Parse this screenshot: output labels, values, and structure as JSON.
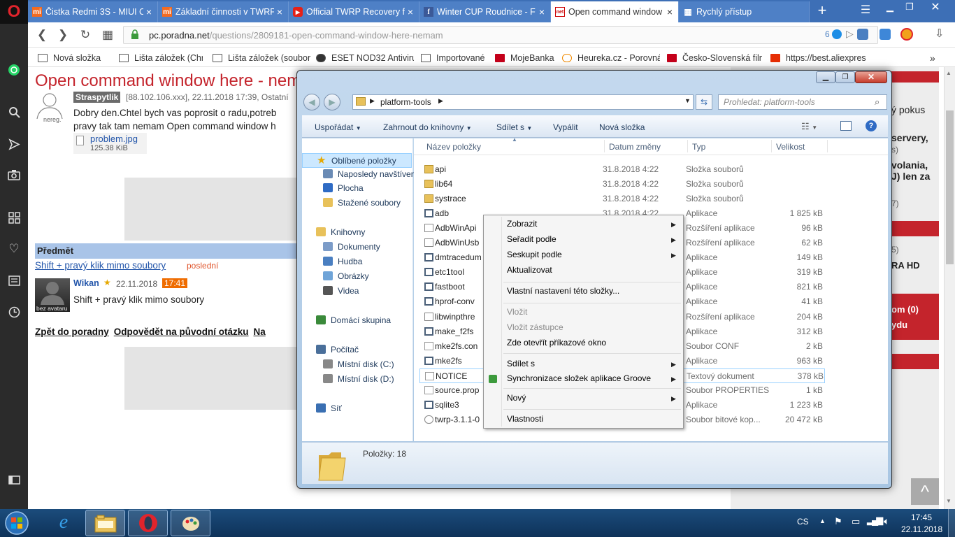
{
  "browser": {
    "tabs": [
      {
        "label": "Čistka Redmi 3S - MIUI C",
        "fav": "mi"
      },
      {
        "label": "Základní činnosti v TWRP",
        "fav": "mi"
      },
      {
        "label": "Official TWRP Recovery f",
        "fav": "yt"
      },
      {
        "label": "Winter CUP Roudnice - F",
        "fav": "fb"
      },
      {
        "label": "Open command window",
        "fav": "net"
      },
      {
        "label": "Rychlý přístup",
        "fav": "grid"
      }
    ],
    "url_host": "pc.poradna.net",
    "url_path": "/questions/2809181-open-command-window-here-nemam",
    "badge_count": "6",
    "bookmarks": [
      "Nová složka",
      "Lišta záložek (Chrome",
      "Lišta záložek (soubor)",
      "ESET NOD32 Antiviru",
      "Importované",
      "MojeBanka",
      "Heureka.cz - Porovná",
      "Česko-Slovenská film",
      "https://best.aliexpres"
    ],
    "bookmarks_more": "»"
  },
  "page": {
    "title": "Open command window here - nemam",
    "author": "Straspytlik",
    "meta": "[88.102.106.xxx], 22.11.2018 17:39, Ostatní",
    "unreg_label": "nereg.",
    "question_line1": "Dobry den.Chtel bych vas poprosit o radu,potreb",
    "question_line2": "pravy tak tam nemam Open command window h",
    "attachment_name": "problem.jpg",
    "attachment_size": "125.38 KiB",
    "subject_header": "Předmět",
    "reply_link": "Shift + pravý klik mimo soubory",
    "reply_tag": "poslední",
    "reply_author": "Wikan",
    "reply_date": "22.11.2018",
    "reply_time": "17:41",
    "avatar_label": "bez avataru",
    "reply_text": "Shift + pravý klik mimo soubory",
    "links": [
      "Zpět do poradny",
      "Odpovědět na původní otázku",
      "Na"
    ],
    "right_fragments": [
      "ý pokus",
      "servery,",
      "s)",
      "volania,",
      "J) len za",
      "7)",
      "5)",
      "RA HD",
      "om (0)",
      "ydu"
    ],
    "scroll_up": "^"
  },
  "explorer": {
    "path": "platform-tools",
    "search_placeholder": "Prohledat: platform-tools",
    "toolbar": [
      "Uspořádat",
      "Zahrnout do knihovny",
      "Sdílet s",
      "Vypálit",
      "Nová složka"
    ],
    "nav": [
      {
        "label": "Oblíbené položky",
        "icon": "star-icon",
        "level": 0
      },
      {
        "label": "Naposledy navštíven",
        "icon": "recent-icon",
        "level": 1
      },
      {
        "label": "Plocha",
        "icon": "desktop-icon",
        "level": 1
      },
      {
        "label": "Stažené soubory",
        "icon": "download-folder-icon",
        "level": 1
      },
      {
        "label": "Knihovny",
        "icon": "library-icon",
        "level": 0
      },
      {
        "label": "Dokumenty",
        "icon": "documents-icon",
        "level": 1
      },
      {
        "label": "Hudba",
        "icon": "music-icon",
        "level": 1
      },
      {
        "label": "Obrázky",
        "icon": "pictures-icon",
        "level": 1
      },
      {
        "label": "Videa",
        "icon": "video-icon",
        "level": 1
      },
      {
        "label": "Domácí skupina",
        "icon": "homegroup-icon",
        "level": 0
      },
      {
        "label": "Počítač",
        "icon": "computer-icon",
        "level": 0
      },
      {
        "label": "Místní disk (C:)",
        "icon": "drive-icon",
        "level": 1
      },
      {
        "label": "Místní disk (D:)",
        "icon": "drive-icon",
        "level": 1
      },
      {
        "label": "Síť",
        "icon": "network-icon",
        "level": 0
      }
    ],
    "columns": [
      "Název položky",
      "Datum změny",
      "Typ",
      "Velikost"
    ],
    "files": [
      {
        "name": "api",
        "date": "31.8.2018 4:22",
        "type": "Složka souborů",
        "size": "",
        "icon": "folder"
      },
      {
        "name": "lib64",
        "date": "31.8.2018 4:22",
        "type": "Složka souborů",
        "size": "",
        "icon": "folder"
      },
      {
        "name": "systrace",
        "date": "31.8.2018 4:22",
        "type": "Složka souborů",
        "size": "",
        "icon": "folder"
      },
      {
        "name": "adb",
        "date": "31.8.2018 4:22",
        "type": "Aplikace",
        "size": "1 825 kB",
        "icon": "app"
      },
      {
        "name": "AdbWinApi",
        "date": "",
        "type": "Rozšíření aplikace",
        "size": "96 kB",
        "icon": "dll"
      },
      {
        "name": "AdbWinUsb",
        "date": "",
        "type": "Rozšíření aplikace",
        "size": "62 kB",
        "icon": "dll"
      },
      {
        "name": "dmtracedum",
        "date": "",
        "type": "Aplikace",
        "size": "149 kB",
        "icon": "app"
      },
      {
        "name": "etc1tool",
        "date": "",
        "type": "Aplikace",
        "size": "319 kB",
        "icon": "app"
      },
      {
        "name": "fastboot",
        "date": "",
        "type": "Aplikace",
        "size": "821 kB",
        "icon": "app"
      },
      {
        "name": "hprof-conv",
        "date": "",
        "type": "Aplikace",
        "size": "41 kB",
        "icon": "app"
      },
      {
        "name": "libwinpthre",
        "date": "",
        "type": "Rozšíření aplikace",
        "size": "204 kB",
        "icon": "dll"
      },
      {
        "name": "make_f2fs",
        "date": "",
        "type": "Aplikace",
        "size": "312 kB",
        "icon": "app"
      },
      {
        "name": "mke2fs.con",
        "date": "",
        "type": "Soubor CONF",
        "size": "2 kB",
        "icon": "file"
      },
      {
        "name": "mke2fs",
        "date": "",
        "type": "Aplikace",
        "size": "963 kB",
        "icon": "app"
      },
      {
        "name": "NOTICE",
        "date": "",
        "type": "Textový dokument",
        "size": "378 kB",
        "icon": "file"
      },
      {
        "name": "source.prop",
        "date": "",
        "type": "Soubor PROPERTIES",
        "size": "1 kB",
        "icon": "file"
      },
      {
        "name": "sqlite3",
        "date": "",
        "type": "Aplikace",
        "size": "1 223 kB",
        "icon": "app"
      },
      {
        "name": "twrp-3.1.1-0",
        "date": "",
        "type": "Soubor bitové kop...",
        "size": "20 472 kB",
        "icon": "disc"
      }
    ],
    "status": "Položky: 18"
  },
  "context_menu": [
    {
      "label": "Zobrazit",
      "submenu": true
    },
    {
      "label": "Seřadit podle",
      "submenu": true
    },
    {
      "label": "Seskupit podle",
      "submenu": true
    },
    {
      "label": "Aktualizovat"
    },
    {
      "sep": true
    },
    {
      "label": "Vlastní nastavení této složky..."
    },
    {
      "sep": true
    },
    {
      "label": "Vložit",
      "disabled": true
    },
    {
      "label": "Vložit zástupce",
      "disabled": true
    },
    {
      "label": "Zde otevřít příkazové okno"
    },
    {
      "sep": true
    },
    {
      "label": "Sdílet s",
      "submenu": true
    },
    {
      "label": "Synchronizace složek aplikace Groove",
      "submenu": true
    },
    {
      "sep": true
    },
    {
      "label": "Nový",
      "submenu": true
    },
    {
      "sep": true
    },
    {
      "label": "Vlastnosti"
    }
  ],
  "taskbar": {
    "lang": "CS",
    "time": "17:45",
    "date": "22.11.2018"
  }
}
